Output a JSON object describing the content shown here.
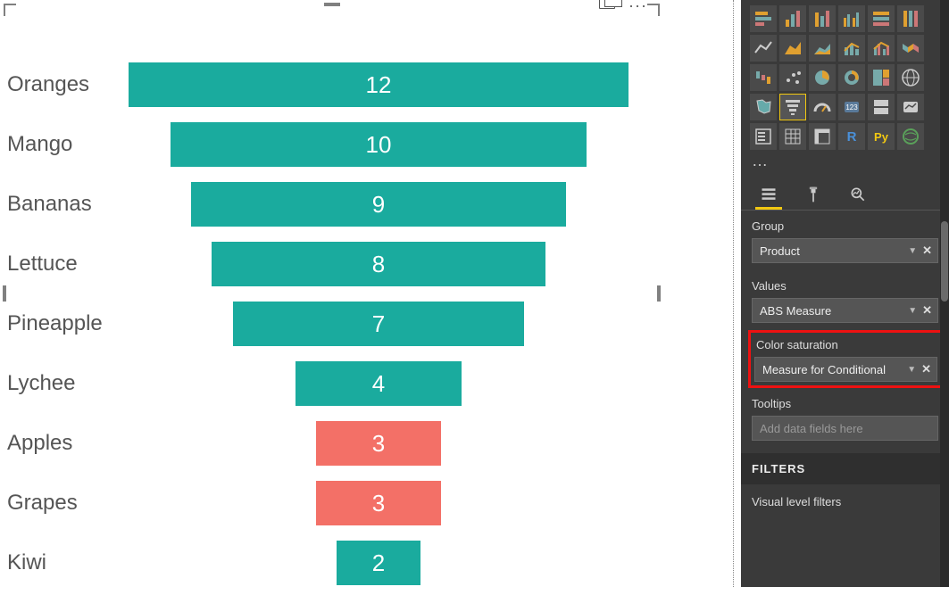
{
  "chart_data": {
    "type": "bar",
    "orientation": "funnel",
    "categories": [
      "Oranges",
      "Mango",
      "Bananas",
      "Lettuce",
      "Pineapple",
      "Lychee",
      "Apples",
      "Grapes",
      "Kiwi"
    ],
    "values": [
      12,
      10,
      9,
      8,
      7,
      4,
      3,
      3,
      2
    ],
    "colors": [
      "#1aab9e",
      "#1aab9e",
      "#1aab9e",
      "#1aab9e",
      "#1aab9e",
      "#1aab9e",
      "#f37067",
      "#f37067",
      "#1aab9e"
    ],
    "title": "",
    "xlabel": "",
    "ylabel": ""
  },
  "panel": {
    "ellipsis": "…",
    "fields": {
      "group_label": "Group",
      "group_value": "Product",
      "values_label": "Values",
      "values_value": "ABS Measure",
      "color_sat_label": "Color saturation",
      "color_sat_value": "Measure for Conditional",
      "tooltips_label": "Tooltips",
      "tooltips_placeholder": "Add data fields here"
    },
    "filters": {
      "header": "FILTERS",
      "visual_level": "Visual level filters"
    }
  },
  "actions": {
    "more": "···"
  }
}
